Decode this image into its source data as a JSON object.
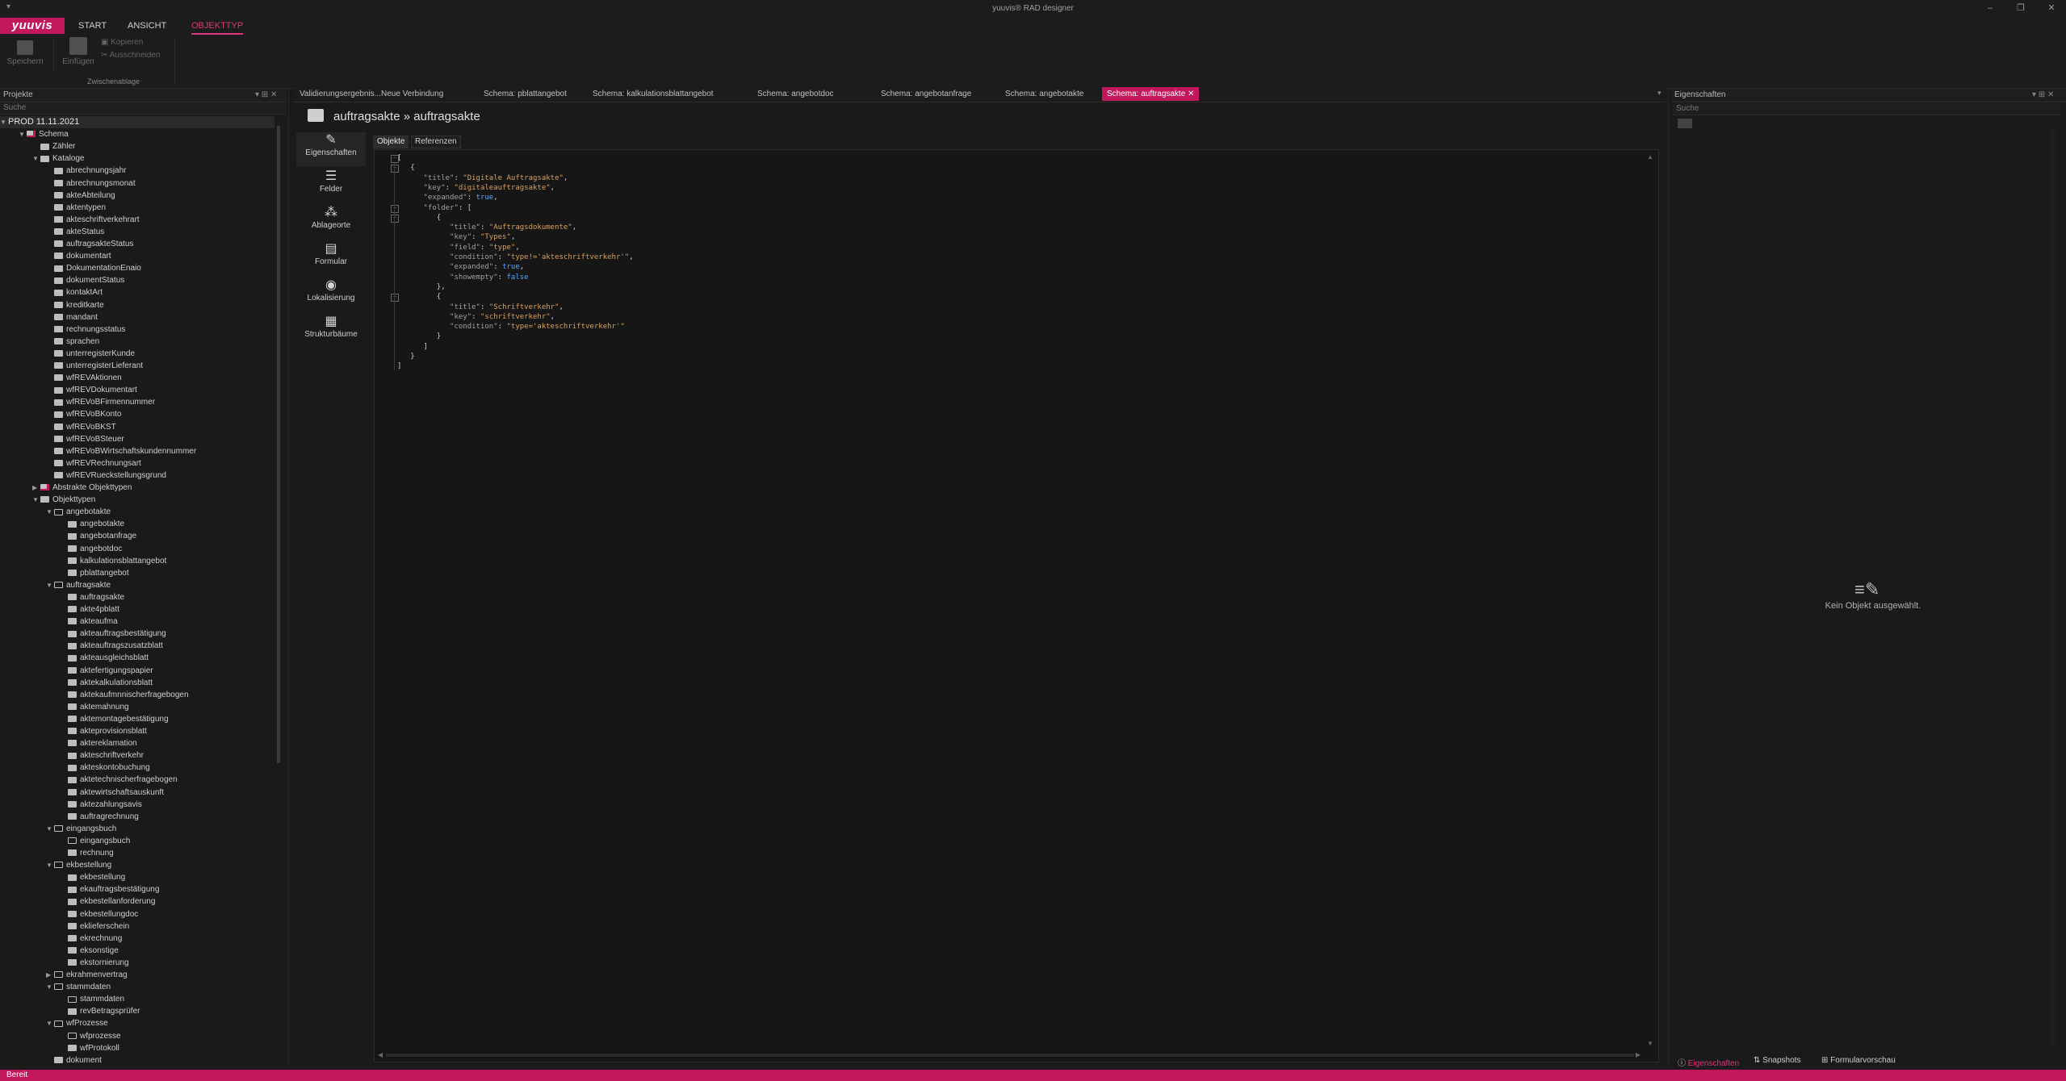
{
  "window": {
    "title": "yuuvis® RAD designer",
    "quick_access": "▾",
    "controls": [
      "–",
      "❐",
      "✕"
    ]
  },
  "menubar": {
    "logo": "yuuvis",
    "items": [
      {
        "label": "START",
        "active": false
      },
      {
        "label": "ANSICHT",
        "active": false
      },
      {
        "label": "OBJEKTTYP",
        "active": true
      }
    ]
  },
  "ribbon": {
    "save": "Speichern",
    "insert": "Einfügen",
    "copy": "Kopieren",
    "cut": "Ausschneiden",
    "group_clipboard": "Zwischenablage"
  },
  "projects_panel": {
    "title": "Projekte",
    "search_placeholder": "Suche",
    "tree": [
      {
        "label": "PROD 11.11.2021",
        "level": 0,
        "toggle": "▼",
        "icon": "none",
        "root": true
      },
      {
        "label": "Schema",
        "level": 1,
        "toggle": "▼",
        "icon": "red"
      },
      {
        "label": "Zähler",
        "level": 2,
        "toggle": "",
        "icon": "box"
      },
      {
        "label": "Kataloge",
        "level": 2,
        "toggle": "▼",
        "icon": "box"
      },
      {
        "label": "abrechnungsjahr",
        "level": 3,
        "toggle": "",
        "icon": "box"
      },
      {
        "label": "abrechnungsmonat",
        "level": 3,
        "toggle": "",
        "icon": "box"
      },
      {
        "label": "akteAbteilung",
        "level": 3,
        "toggle": "",
        "icon": "box"
      },
      {
        "label": "aktentypen",
        "level": 3,
        "toggle": "",
        "icon": "box"
      },
      {
        "label": "akteschriftverkehrart",
        "level": 3,
        "toggle": "",
        "icon": "box"
      },
      {
        "label": "akteStatus",
        "level": 3,
        "toggle": "",
        "icon": "box"
      },
      {
        "label": "auftragsakteStatus",
        "level": 3,
        "toggle": "",
        "icon": "box"
      },
      {
        "label": "dokumentart",
        "level": 3,
        "toggle": "",
        "icon": "box"
      },
      {
        "label": "DokumentationEnaio",
        "level": 3,
        "toggle": "",
        "icon": "box"
      },
      {
        "label": "dokumentStatus",
        "level": 3,
        "toggle": "",
        "icon": "box"
      },
      {
        "label": "kontaktArt",
        "level": 3,
        "toggle": "",
        "icon": "box"
      },
      {
        "label": "kreditkarte",
        "level": 3,
        "toggle": "",
        "icon": "box"
      },
      {
        "label": "mandant",
        "level": 3,
        "toggle": "",
        "icon": "box"
      },
      {
        "label": "rechnungsstatus",
        "level": 3,
        "toggle": "",
        "icon": "box"
      },
      {
        "label": "sprachen",
        "level": 3,
        "toggle": "",
        "icon": "box"
      },
      {
        "label": "unterregisterKunde",
        "level": 3,
        "toggle": "",
        "icon": "box"
      },
      {
        "label": "unterregisterLieferant",
        "level": 3,
        "toggle": "",
        "icon": "box"
      },
      {
        "label": "wfREVAktionen",
        "level": 3,
        "toggle": "",
        "icon": "box"
      },
      {
        "label": "wfREVDokumentart",
        "level": 3,
        "toggle": "",
        "icon": "box"
      },
      {
        "label": "wfREVoBFirmennummer",
        "level": 3,
        "toggle": "",
        "icon": "box"
      },
      {
        "label": "wfREVoBKonto",
        "level": 3,
        "toggle": "",
        "icon": "box"
      },
      {
        "label": "wfREVoBKST",
        "level": 3,
        "toggle": "",
        "icon": "box"
      },
      {
        "label": "wfREVoBSteuer",
        "level": 3,
        "toggle": "",
        "icon": "box"
      },
      {
        "label": "wfREVoBWirtschaftskundennummer",
        "level": 3,
        "toggle": "",
        "icon": "box"
      },
      {
        "label": "wfREVRechnungsart",
        "level": 3,
        "toggle": "",
        "icon": "box"
      },
      {
        "label": "wfREVRueckstellungsgrund",
        "level": 3,
        "toggle": "",
        "icon": "box"
      },
      {
        "label": "Abstrakte Objekttypen",
        "level": 2,
        "toggle": "▶",
        "icon": "red"
      },
      {
        "label": "Objekttypen",
        "level": 2,
        "toggle": "▼",
        "icon": "box"
      },
      {
        "label": "angebotakte",
        "level": 3,
        "toggle": "▼",
        "icon": "folder"
      },
      {
        "label": "angebotakte",
        "level": 4,
        "toggle": "",
        "icon": "box"
      },
      {
        "label": "angebotanfrage",
        "level": 4,
        "toggle": "",
        "icon": "box"
      },
      {
        "label": "angebotdoc",
        "level": 4,
        "toggle": "",
        "icon": "box"
      },
      {
        "label": "kalkulationsblattangebot",
        "level": 4,
        "toggle": "",
        "icon": "box"
      },
      {
        "label": "pblattangebot",
        "level": 4,
        "toggle": "",
        "icon": "box"
      },
      {
        "label": "auftragsakte",
        "level": 3,
        "toggle": "▼",
        "icon": "folder"
      },
      {
        "label": "auftragsakte",
        "level": 4,
        "toggle": "",
        "icon": "box"
      },
      {
        "label": "akte4pblatt",
        "level": 4,
        "toggle": "",
        "icon": "box"
      },
      {
        "label": "akteaufma",
        "level": 4,
        "toggle": "",
        "icon": "box"
      },
      {
        "label": "akteauftragsbestätigung",
        "level": 4,
        "toggle": "",
        "icon": "box"
      },
      {
        "label": "akteauftragszusatzblatt",
        "level": 4,
        "toggle": "",
        "icon": "box"
      },
      {
        "label": "akteausgleichsblatt",
        "level": 4,
        "toggle": "",
        "icon": "box"
      },
      {
        "label": "aktefertigungspapier",
        "level": 4,
        "toggle": "",
        "icon": "box"
      },
      {
        "label": "aktekalkulationsblatt",
        "level": 4,
        "toggle": "",
        "icon": "box"
      },
      {
        "label": "aktekaufmnnischerfragebogen",
        "level": 4,
        "toggle": "",
        "icon": "box"
      },
      {
        "label": "aktemahnung",
        "level": 4,
        "toggle": "",
        "icon": "box"
      },
      {
        "label": "aktemontagebestätigung",
        "level": 4,
        "toggle": "",
        "icon": "box"
      },
      {
        "label": "akteprovisionsblatt",
        "level": 4,
        "toggle": "",
        "icon": "box"
      },
      {
        "label": "aktereklamation",
        "level": 4,
        "toggle": "",
        "icon": "box"
      },
      {
        "label": "akteschriftverkehr",
        "level": 4,
        "toggle": "",
        "icon": "box"
      },
      {
        "label": "akteskontobuchung",
        "level": 4,
        "toggle": "",
        "icon": "box"
      },
      {
        "label": "aktetechnischerfragebogen",
        "level": 4,
        "toggle": "",
        "icon": "box"
      },
      {
        "label": "aktewirtschaftsauskunft",
        "level": 4,
        "toggle": "",
        "icon": "box"
      },
      {
        "label": "aktezahlungsavis",
        "level": 4,
        "toggle": "",
        "icon": "box"
      },
      {
        "label": "auftragrechnung",
        "level": 4,
        "toggle": "",
        "icon": "box"
      },
      {
        "label": "eingangsbuch",
        "level": 3,
        "toggle": "▼",
        "icon": "folder"
      },
      {
        "label": "eingangsbuch",
        "level": 4,
        "toggle": "",
        "icon": "folder"
      },
      {
        "label": "rechnung",
        "level": 4,
        "toggle": "",
        "icon": "box"
      },
      {
        "label": "ekbestellung",
        "level": 3,
        "toggle": "▼",
        "icon": "folder"
      },
      {
        "label": "ekbestellung",
        "level": 4,
        "toggle": "",
        "icon": "box"
      },
      {
        "label": "ekauftragsbestätigung",
        "level": 4,
        "toggle": "",
        "icon": "box"
      },
      {
        "label": "ekbestellanforderung",
        "level": 4,
        "toggle": "",
        "icon": "box"
      },
      {
        "label": "ekbestellungdoc",
        "level": 4,
        "toggle": "",
        "icon": "box"
      },
      {
        "label": "eklieferschein",
        "level": 4,
        "toggle": "",
        "icon": "box"
      },
      {
        "label": "ekrechnung",
        "level": 4,
        "toggle": "",
        "icon": "box"
      },
      {
        "label": "eksonstige",
        "level": 4,
        "toggle": "",
        "icon": "box"
      },
      {
        "label": "ekstornierung",
        "level": 4,
        "toggle": "",
        "icon": "box"
      },
      {
        "label": "ekrahmenvertrag",
        "level": 3,
        "toggle": "▶",
        "icon": "folder"
      },
      {
        "label": "stammdaten",
        "level": 3,
        "toggle": "▼",
        "icon": "folder"
      },
      {
        "label": "stammdaten",
        "level": 4,
        "toggle": "",
        "icon": "folder"
      },
      {
        "label": "revBetragsprüfer",
        "level": 4,
        "toggle": "",
        "icon": "box"
      },
      {
        "label": "wfProzesse",
        "level": 3,
        "toggle": "▼",
        "icon": "folder"
      },
      {
        "label": "wfprozesse",
        "level": 4,
        "toggle": "",
        "icon": "folder"
      },
      {
        "label": "wfProtokoll",
        "level": 4,
        "toggle": "",
        "icon": "box"
      },
      {
        "label": "dokument",
        "level": 3,
        "toggle": "",
        "icon": "box"
      }
    ]
  },
  "doc_tabs": [
    {
      "label": "Validierungsergebnis...Neue Verbindung",
      "active": false
    },
    {
      "label": "Schema: pblattangebot",
      "active": false
    },
    {
      "label": "Schema: kalkulationsblattangebot",
      "active": false
    },
    {
      "label": "Schema: angebotdoc",
      "active": false
    },
    {
      "label": "Schema: angebotanfrage",
      "active": false
    },
    {
      "label": "Schema: angebotakte",
      "active": false
    },
    {
      "label": "Schema: auftragsakte",
      "active": true
    }
  ],
  "editor": {
    "title": "auftragsakte » auftragsakte",
    "side_nav": [
      {
        "label": "Eigenschaften",
        "icon": "✎",
        "active": true
      },
      {
        "label": "Felder",
        "icon": "☰",
        "active": false
      },
      {
        "label": "Ablageorte",
        "icon": "⁂",
        "active": false
      },
      {
        "label": "Formular",
        "icon": "▤",
        "active": false
      },
      {
        "label": "Lokalisierung",
        "icon": "◉",
        "active": false
      },
      {
        "label": "Strukturbäume",
        "icon": "▦",
        "active": false
      }
    ],
    "sub_tabs": [
      {
        "label": "Objekte",
        "active": true
      },
      {
        "label": "Referenzen",
        "active": false
      }
    ],
    "code": [
      {
        "indent": 0,
        "text": "[",
        "fold": true
      },
      {
        "indent": 1,
        "text": "{",
        "fold": true
      },
      {
        "indent": 2,
        "key": "\"title\"",
        "val": "\"Digitale Auftragsakte\"",
        "type": "s",
        "comma": true
      },
      {
        "indent": 2,
        "key": "\"key\"",
        "val": "\"digitaleauftragsakte\"",
        "type": "s",
        "comma": true
      },
      {
        "indent": 2,
        "key": "\"expanded\"",
        "val": "true",
        "type": "b",
        "comma": true
      },
      {
        "indent": 2,
        "key": "\"folder\"",
        "val": "[",
        "type": "p",
        "fold": true
      },
      {
        "indent": 3,
        "text": "{",
        "fold": true
      },
      {
        "indent": 4,
        "key": "\"title\"",
        "val": "\"Auftragsdokumente\"",
        "type": "s",
        "comma": true
      },
      {
        "indent": 4,
        "key": "\"key\"",
        "val": "\"Types\"",
        "type": "s",
        "comma": true
      },
      {
        "indent": 4,
        "key": "\"field\"",
        "val": "\"type\"",
        "type": "s",
        "comma": true
      },
      {
        "indent": 4,
        "key": "\"condition\"",
        "val": "\"type!='akteschriftverkehr'\"",
        "type": "s",
        "comma": true
      },
      {
        "indent": 4,
        "key": "\"expanded\"",
        "val": "true",
        "type": "b",
        "comma": true
      },
      {
        "indent": 4,
        "key": "\"showempty\"",
        "val": "false",
        "type": "b",
        "comma": false
      },
      {
        "indent": 3,
        "text": "},"
      },
      {
        "indent": 3,
        "text": "{",
        "fold": true
      },
      {
        "indent": 4,
        "key": "\"title\"",
        "val": "\"Schriftverkehr\"",
        "type": "s",
        "comma": true
      },
      {
        "indent": 4,
        "key": "\"key\"",
        "val": "\"schriftverkehr\"",
        "type": "s",
        "comma": true
      },
      {
        "indent": 4,
        "key": "\"condition\"",
        "val": "\"type='akteschriftverkehr'\"",
        "type": "s",
        "comma": false
      },
      {
        "indent": 3,
        "text": "}"
      },
      {
        "indent": 2,
        "text": "]"
      },
      {
        "indent": 1,
        "text": "}"
      },
      {
        "indent": 0,
        "text": "]"
      }
    ]
  },
  "properties_panel": {
    "title": "Eigenschaften",
    "search_placeholder": "Suche",
    "empty_text": "Kein Objekt ausgewählt.",
    "bottom_tabs": [
      {
        "label": "Eigenschaften",
        "active": true
      },
      {
        "label": "Snapshots",
        "active": false
      },
      {
        "label": "Formularvorschau",
        "active": false
      }
    ]
  },
  "statusbar": {
    "text": "Bereit"
  },
  "colors": {
    "accent": "#c2185b",
    "string": "#d9a05b",
    "bool": "#58a6ff"
  }
}
